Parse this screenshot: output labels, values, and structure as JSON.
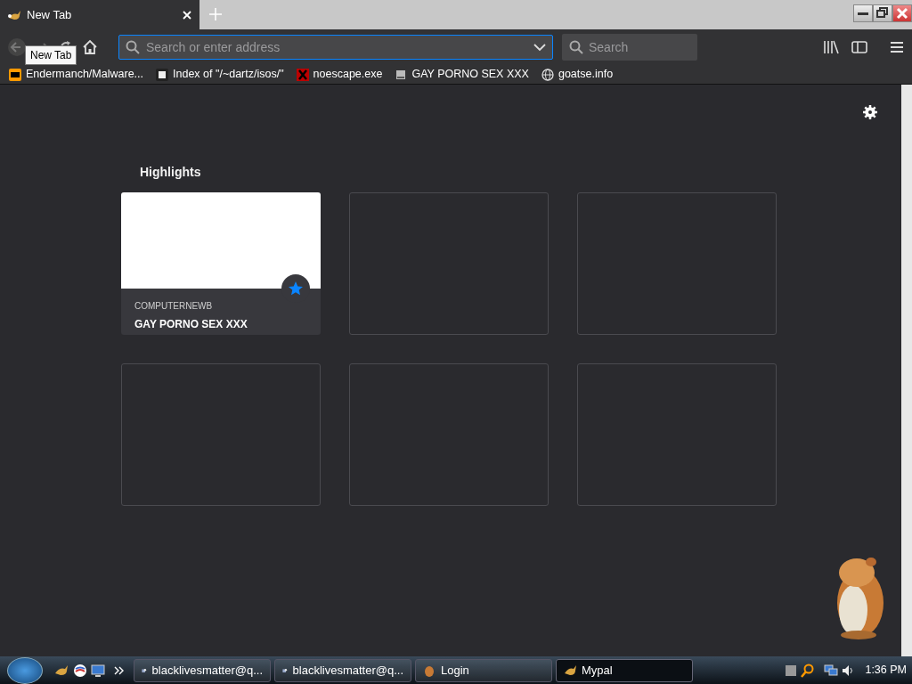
{
  "tabs": [
    {
      "title": "New Tab",
      "selected": true
    }
  ],
  "tooltip": "New Tab",
  "toolbar": {
    "address": {
      "placeholder": "Search or enter address"
    },
    "search": {
      "placeholder": "Search"
    }
  },
  "bookmarks": [
    {
      "label": "Endermanch/Malware..."
    },
    {
      "label": "Index of \"/~dartz/isos/\""
    },
    {
      "label": "noescape.exe"
    },
    {
      "label": "GAY PORNO SEX XXX"
    },
    {
      "label": "goatse.info"
    }
  ],
  "highlights": {
    "title": "Highlights",
    "cards": [
      {
        "kind": "bookmark",
        "source": "COMPUTERNEWB",
        "title": "GAY PORNO SEX XXX",
        "bookmarked": true
      },
      {
        "kind": "empty"
      },
      {
        "kind": "empty"
      },
      {
        "kind": "empty"
      },
      {
        "kind": "empty"
      },
      {
        "kind": "empty"
      }
    ]
  },
  "taskbar": {
    "items": [
      {
        "label": "blacklivesmatter@q...",
        "selected": false
      },
      {
        "label": "blacklivesmatter@q...",
        "selected": false
      },
      {
        "label": "Login",
        "selected": false
      },
      {
        "label": "Mypal",
        "selected": true
      }
    ],
    "clock": "1:36 PM"
  }
}
